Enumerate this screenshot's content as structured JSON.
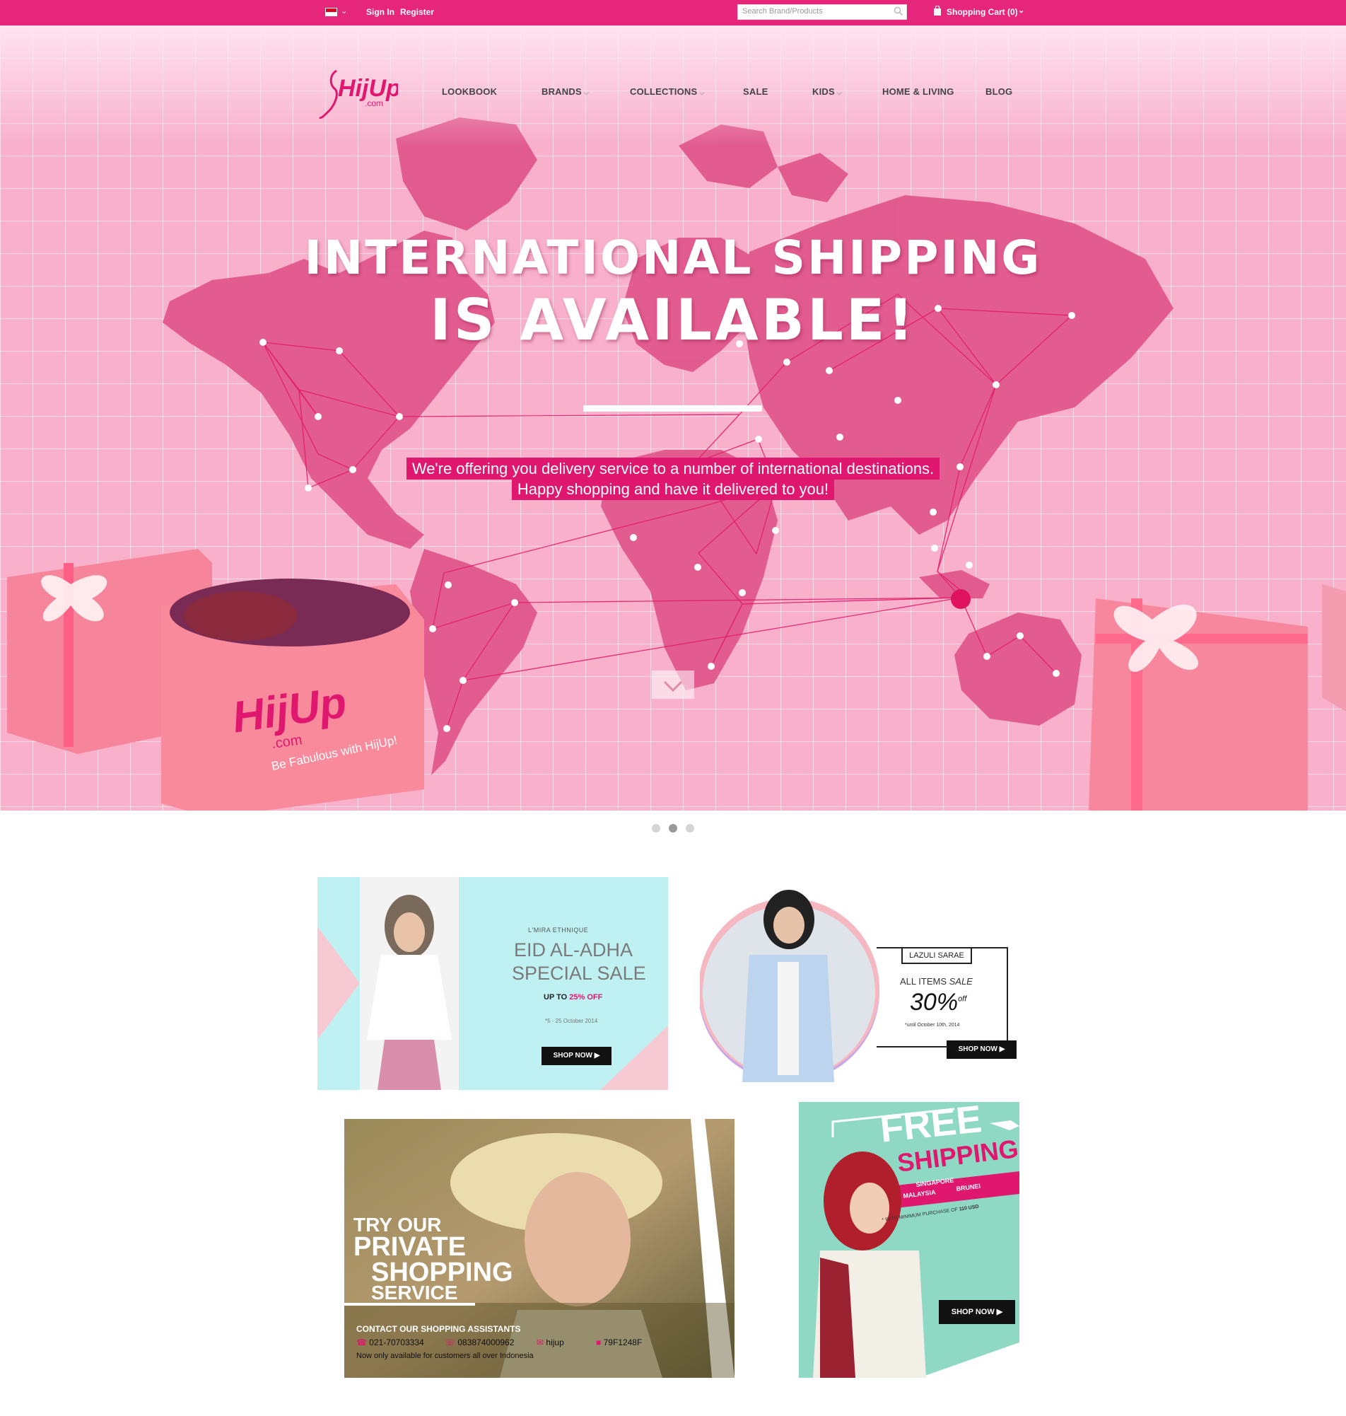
{
  "topbar": {
    "signin": "Sign In",
    "register": "Register",
    "search_placeholder": "Search Brand/Products",
    "cart": "Shopping Cart (0)"
  },
  "logo": {
    "brand": "HijUp",
    "domain": ".com"
  },
  "nav": [
    "LOOKBOOK",
    "BRANDS",
    "COLLECTIONS",
    "SALE",
    "KIDS",
    "HOME & LIVING",
    "BLOG"
  ],
  "hero": {
    "title_line1": "INTERNATIONAL SHIPPING",
    "title_line2": "IS AVAILABLE!",
    "sub_line1": "We're offering you delivery service to a number of international destinations.",
    "sub_line2": "Happy shopping and have it delivered to you!",
    "box_tagline": "Be Fabulous with HijUp!"
  },
  "carousel": {
    "slides": 3,
    "active": 2
  },
  "colors": {
    "brand_pink": "#e5267a",
    "hero_bg": "#f8b0cb",
    "map": "#e0578c"
  },
  "banner_eid": {
    "brand": "L'MIRA ETHNIQUE",
    "title1": "EID AL-ADHA",
    "title2": "SPECIAL SALE",
    "discount_prefix": "UP TO",
    "discount": "25% OFF",
    "dates": "*5 - 25 October 2014",
    "cta": "SHOP NOW"
  },
  "banner_lazuli": {
    "brand": "LAZULI SARAE",
    "line": "ALL ITEMS",
    "line_em": "SALE",
    "percent": "30%",
    "off": "off",
    "until": "*until October 10th, 2014",
    "cta": "SHOP NOW"
  },
  "banner_private": {
    "line1": "TRY OUR",
    "line2": "PRIVATE",
    "line3": "SHOPPING",
    "line4": "SERVICE",
    "contact_title": "CONTACT OUR SHOPPING ASSISTANTS",
    "phone": "021-70703334",
    "whatsapp": "083874000962",
    "line_id": "hijup",
    "bbm": "79F1248F",
    "note": "Now only available for customers all over Indonesia"
  },
  "banner_shipping": {
    "free": "FREE",
    "shipping": "SHIPPING",
    "countries1": "SINGAPORE",
    "countries2": "MALAYSIA",
    "countries3": "BRUNEI",
    "min": "* WITH MINIMUM PURCHASE OF",
    "min_amount": "110 USD",
    "cta": "SHOP NOW"
  }
}
